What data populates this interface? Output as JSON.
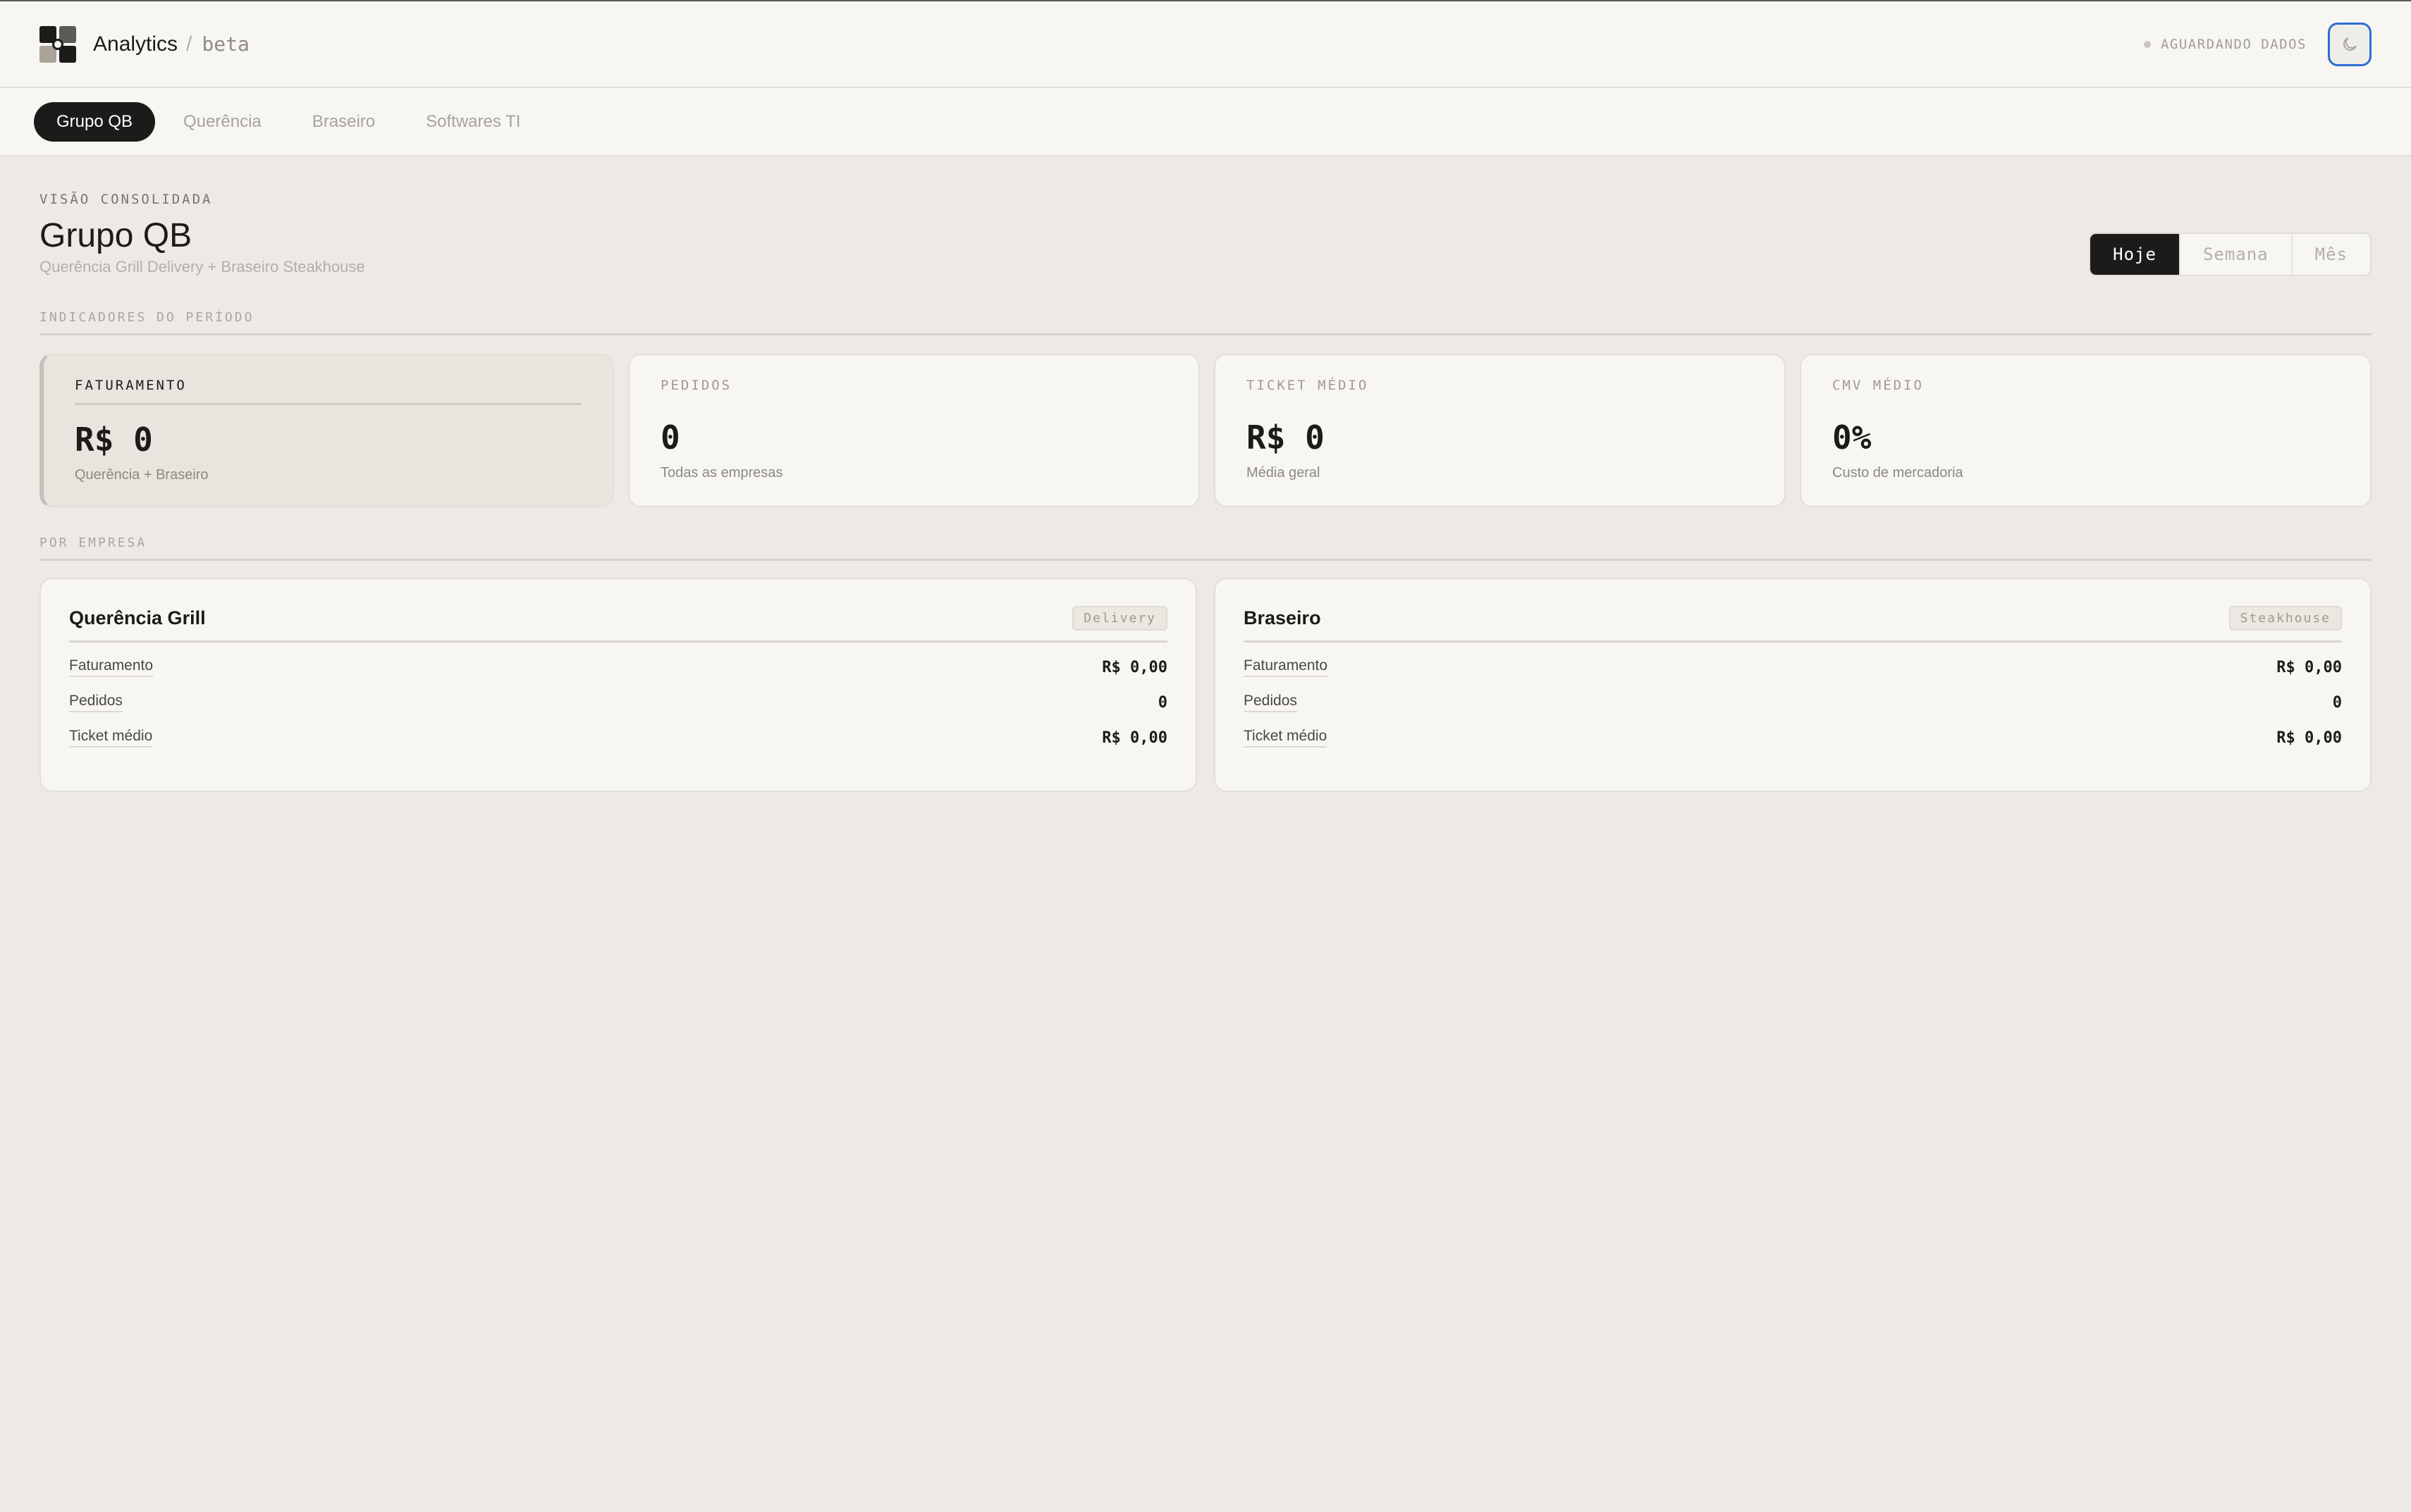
{
  "header": {
    "app_name": "Analytics",
    "separator": "/",
    "tag": "beta",
    "status": "AGUARDANDO DADOS"
  },
  "tabs": [
    {
      "label": "Grupo QB",
      "active": true
    },
    {
      "label": "Querência",
      "active": false
    },
    {
      "label": "Braseiro",
      "active": false
    },
    {
      "label": "Softwares TI",
      "active": false
    }
  ],
  "page": {
    "eyebrow": "VISÃO CONSOLIDADA",
    "title": "Grupo QB",
    "subtitle": "Querência Grill Delivery + Braseiro Steakhouse"
  },
  "period": {
    "options": [
      "Hoje",
      "Semana",
      "Mês"
    ],
    "selected": "Hoje"
  },
  "sections": {
    "indicators": "INDICADORES DO PERÍODO",
    "by_company": "POR EMPRESA"
  },
  "kpis": [
    {
      "label": "FATURAMENTO",
      "value": "R$ 0",
      "note": "Querência + Braseiro",
      "active": true
    },
    {
      "label": "PEDIDOS",
      "value": "0",
      "note": "Todas as empresas",
      "active": false
    },
    {
      "label": "TICKET MÉDIO",
      "value": "R$ 0",
      "note": "Média geral",
      "active": false
    },
    {
      "label": "CMV MÉDIO",
      "value": "0%",
      "note": "Custo de mercadoria",
      "active": false
    }
  ],
  "companies": [
    {
      "name": "Querência Grill",
      "badge": "Delivery",
      "rows": [
        {
          "label": "Faturamento",
          "value": "R$ 0,00"
        },
        {
          "label": "Pedidos",
          "value": "0"
        },
        {
          "label": "Ticket médio",
          "value": "R$ 0,00"
        }
      ]
    },
    {
      "name": "Braseiro",
      "badge": "Steakhouse",
      "rows": [
        {
          "label": "Faturamento",
          "value": "R$ 0,00"
        },
        {
          "label": "Pedidos",
          "value": "0"
        },
        {
          "label": "Ticket médio",
          "value": "R$ 0,00"
        }
      ]
    }
  ],
  "icons": {
    "logo": "grid-logo-icon",
    "theme": "moon-icon",
    "status": "status-dot-icon"
  },
  "colors": {
    "background": "#edeae5",
    "surface": "#f7f6f2",
    "accent_dark": "#1c1b19",
    "focus_ring": "#2f6fd1"
  }
}
